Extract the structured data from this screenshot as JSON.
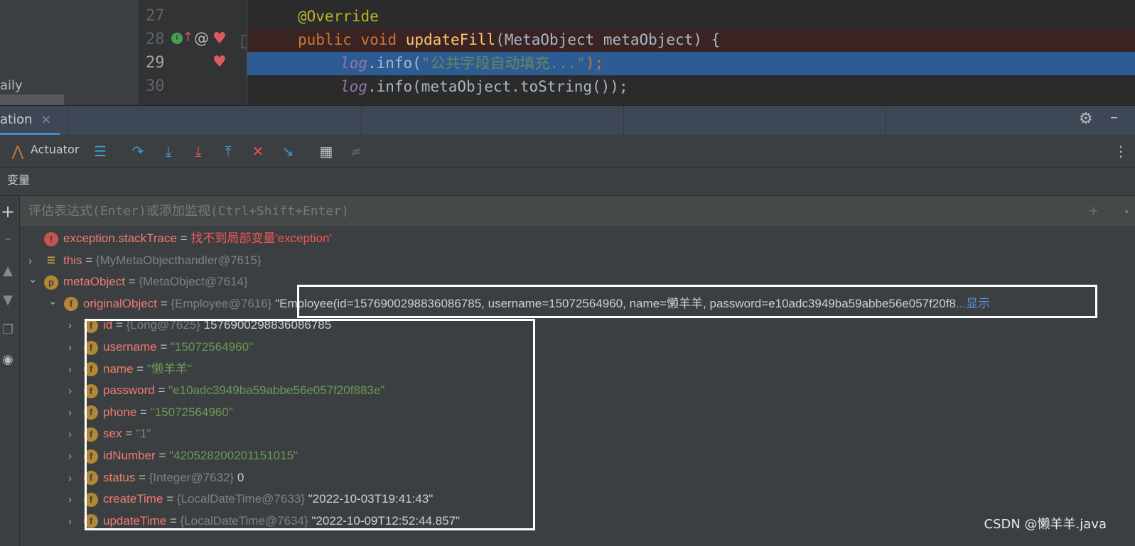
{
  "project_panel": {
    "partial_text": "aily"
  },
  "editor": {
    "lines": [
      {
        "num": "27",
        "text": "@Override"
      },
      {
        "num": "28",
        "kw1": "public",
        "kw2": "void",
        "fn": "updateFill",
        "rest": "(MetaObject metaObject) {"
      },
      {
        "num": "29",
        "lg": "log",
        "mid": ".info(",
        "str": "\"公共字段自动填充...\"",
        "end": ");"
      },
      {
        "num": "30",
        "lg": "log",
        "rest": ".info(metaObject.toString());"
      }
    ]
  },
  "tab": {
    "label": "ation",
    "close": "×"
  },
  "toolbar": {
    "actuator_label": "Actuator"
  },
  "variables_header": "变量",
  "eval": {
    "placeholder": "评估表达式(Enter)或添加监视(Ctrl+Shift+Enter)"
  },
  "colors": {
    "accent": "#4a88c7",
    "field_icon": "#b18835",
    "name": "#f07b72",
    "string": "#6a9955",
    "error": "#f25757"
  },
  "tree": [
    {
      "icon": "error-icon",
      "name": "exception.stackTrace",
      "eq": " = ",
      "error": "找不到局部变量'exception'"
    },
    {
      "icon": "stack-icon",
      "name": "this",
      "eq": " = ",
      "type": "{MyMetaObjecthandler@7615}"
    },
    {
      "icon": "p",
      "name": "metaObject",
      "eq": " = ",
      "type": "{MetaObject@7614}"
    },
    {
      "icon": "f",
      "name": "originalObject",
      "eq": " = ",
      "type": "{Employee@7616}",
      "value": " \"Employee(id=1576900298836086785, username=15072564960, name=懒羊羊, password=e10adc3949ba59abbe56e057f20f8",
      "more": "...显示"
    },
    {
      "icon": "f",
      "name": "id",
      "eq": " = ",
      "type": "{Long@7625}",
      "value": " 1576900298836086785"
    },
    {
      "icon": "f",
      "name": "username",
      "eq": " = ",
      "str": "\"15072564960\""
    },
    {
      "icon": "f",
      "name": "name",
      "eq": " = ",
      "str": "\"懒羊羊\""
    },
    {
      "icon": "f",
      "name": "password",
      "eq": " = ",
      "str": "\"e10adc3949ba59abbe56e057f20f883e\""
    },
    {
      "icon": "f",
      "name": "phone",
      "eq": " = ",
      "str": "\"15072564960\""
    },
    {
      "icon": "f",
      "name": "sex",
      "eq": " = ",
      "str": "\"1\""
    },
    {
      "icon": "f",
      "name": "idNumber",
      "eq": " = ",
      "str": "\"420528200201151015\""
    },
    {
      "icon": "f",
      "name": "status",
      "eq": " = ",
      "type": "{Integer@7632}",
      "value": " 0"
    },
    {
      "icon": "f",
      "name": "createTime",
      "eq": " = ",
      "type": "{LocalDateTime@7633}",
      "value": " \"2022-10-03T19:41:43\""
    },
    {
      "icon": "f",
      "name": "updateTime",
      "eq": " = ",
      "type": "{LocalDateTime@7634}",
      "value": " \"2022-10-09T12:52:44.857\""
    }
  ],
  "watermark": "CSDN @懒羊羊.java"
}
